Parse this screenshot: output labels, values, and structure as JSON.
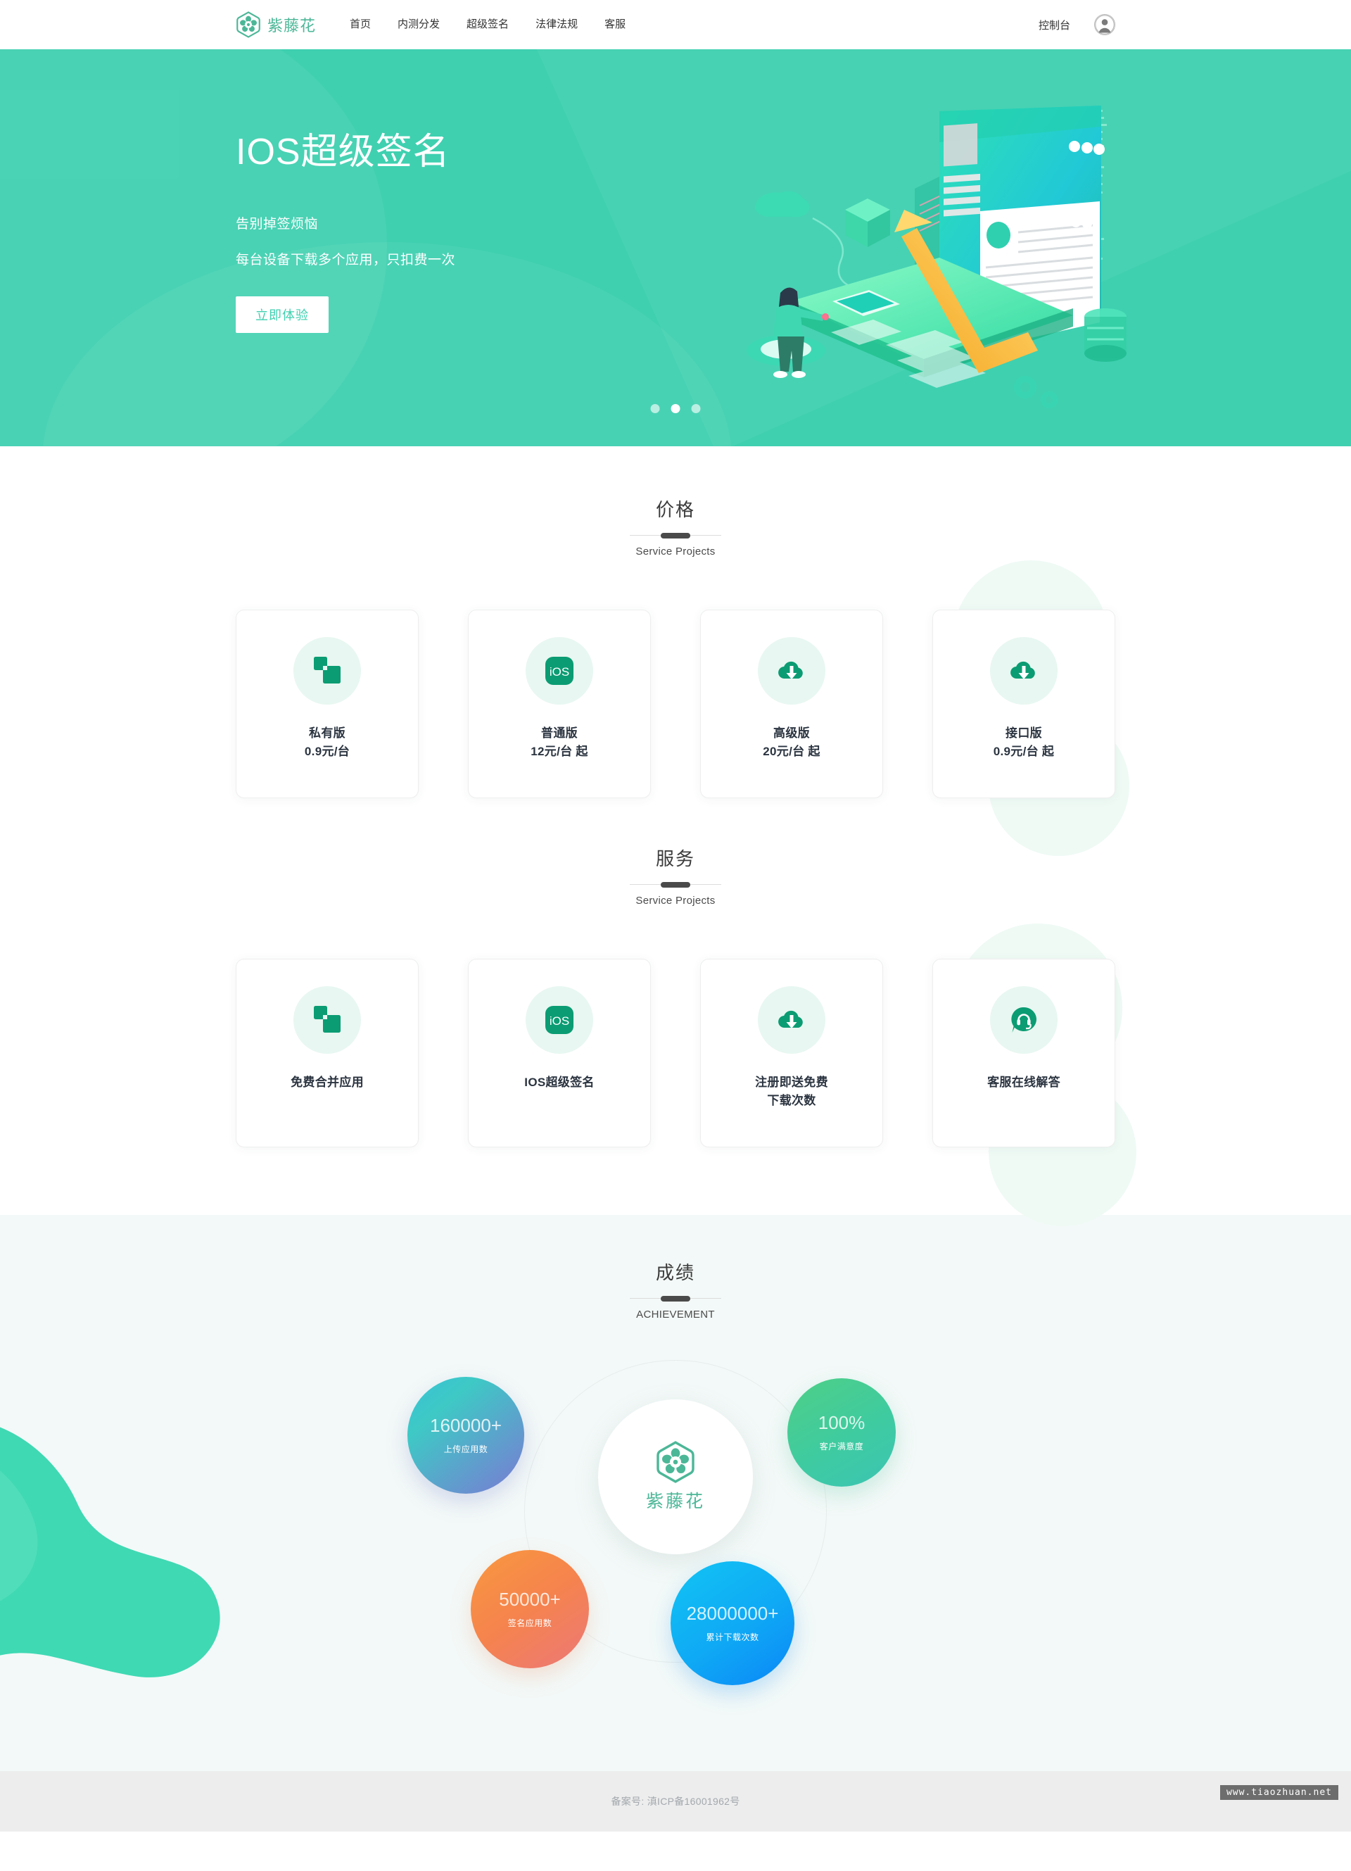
{
  "header": {
    "brand_name": "紫藤花",
    "brand_icon": "flower-logo-icon",
    "nav": [
      {
        "label": "首页"
      },
      {
        "label": "内测分发"
      },
      {
        "label": "超级签名"
      },
      {
        "label": "法律法规"
      },
      {
        "label": "客服"
      }
    ],
    "console_label": "控制台",
    "avatar_icon": "user-avatar-icon"
  },
  "hero": {
    "title": "IOS超级签名",
    "sub1": "告别掉签烦恼",
    "sub2": "每台设备下载多个应用，只扣费一次",
    "cta_label": "立即体验",
    "illustration_name": "isometric-devices-illustration",
    "dots": [
      {
        "active": false
      },
      {
        "active": true
      },
      {
        "active": false
      }
    ],
    "bg_color": "#3fd0b0"
  },
  "pricing": {
    "title": "价格",
    "subtitle": "Service Projects",
    "cards": [
      {
        "icon": "squares-icon",
        "label": "私有版",
        "price": "0.9元/台"
      },
      {
        "icon": "ios-badge-icon",
        "label": "普通版",
        "price": "12元/台 起"
      },
      {
        "icon": "cloud-download-icon",
        "label": "高级版",
        "price": "20元/台 起"
      },
      {
        "icon": "cloud-download-icon",
        "label": "接口版",
        "price": "0.9元/台 起"
      }
    ]
  },
  "services": {
    "title": "服务",
    "subtitle": "Service Projects",
    "cards": [
      {
        "icon": "squares-icon",
        "label": "免费合并应用"
      },
      {
        "icon": "ios-badge-icon",
        "label": "IOS超级签名"
      },
      {
        "icon": "cloud-download-icon",
        "label": "注册即送免费\n下载次数"
      },
      {
        "icon": "headset-chat-icon",
        "label": "客服在线解答"
      }
    ]
  },
  "achievement": {
    "title": "成绩",
    "subtitle": "ACHIEVEMENT",
    "hub_name": "紫藤花",
    "hub_icon": "flower-logo-icon",
    "bubbles": [
      {
        "value": "160000+",
        "caption": "上传应用数",
        "color": "#5ac0d4"
      },
      {
        "value": "100%",
        "caption": "客户满意度",
        "color": "#45cb9c"
      },
      {
        "value": "50000+",
        "caption": "签名应用数",
        "color": "#f48a4a"
      },
      {
        "value": "28000000+",
        "caption": "累计下载次数",
        "color": "#0fa5f4"
      }
    ]
  },
  "footer": {
    "icp_text": "备案号: 滇ICP备16001962号",
    "watermark": "www.tiaozhuan.net"
  }
}
